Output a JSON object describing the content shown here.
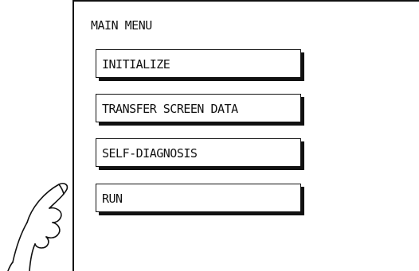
{
  "menu": {
    "title": "MAIN MENU",
    "items": [
      {
        "label": "INITIALIZE"
      },
      {
        "label": "TRANSFER SCREEN DATA"
      },
      {
        "label": "SELF-DIAGNOSIS"
      },
      {
        "label": "RUN"
      }
    ]
  },
  "illustration": {
    "icon": "pointing-hand-icon"
  }
}
